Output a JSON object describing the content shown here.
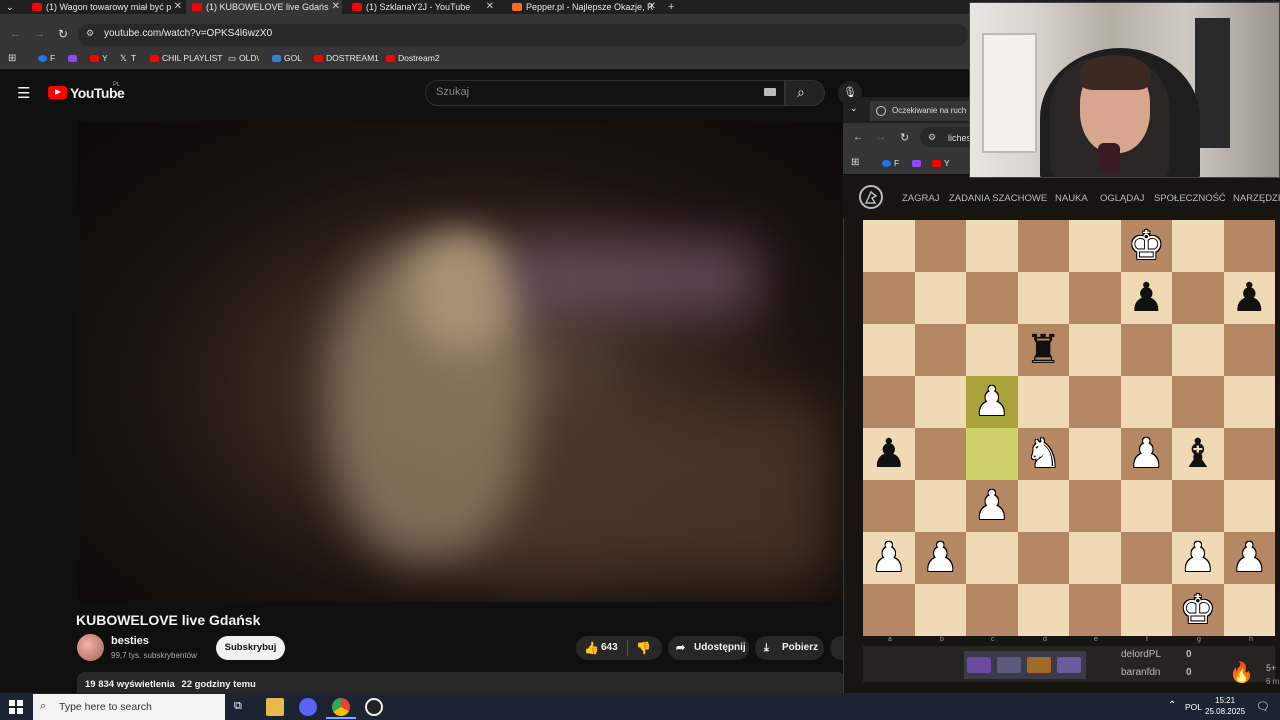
{
  "browser": {
    "tabs": [
      {
        "title": "(1) Wagon towarowy miał być p",
        "active": false
      },
      {
        "title": "(1) KUBOWELOVE live Gdańs",
        "active": true
      },
      {
        "title": "(1) SzklanaY2J - YouTube",
        "active": false
      },
      {
        "title": "Pepper.pl - Najlepsze Okazje, R",
        "active": false
      }
    ],
    "new_tab": "+",
    "url": "youtube.com/watch?v=OPKS4l6wzX0",
    "bookmarks": [
      "F",
      "Y",
      "T",
      "CHIL PLAYLIST",
      "OLD\\",
      "GOL",
      "DOSTREAM1",
      "Dostream2"
    ]
  },
  "youtube": {
    "logo_text": "YouTube",
    "region": "PL",
    "search_placeholder": "Szukaj",
    "video_title": "KUBOWELOVE live Gdańsk",
    "channel_name": "besties",
    "subscribers": "99,7 tys. subskrybentów",
    "subscribe_label": "Subskrybuj",
    "likes": "643",
    "share_label": "Udostępnij",
    "download_label": "Pobierz",
    "views": "19 834 wyświetlenia",
    "age": "22 godziny temu"
  },
  "lichess": {
    "tab_title": "Oczekiwanie na ruch p",
    "url": "liches",
    "bookmarks": [
      "F",
      "Y"
    ],
    "nav": [
      "ZAGRAJ",
      "ZADANIA SZACHOWE",
      "NAUKA",
      "OGLĄDAJ",
      "SPOŁECZNOŚĆ",
      "NARZĘDZIA"
    ],
    "files": [
      "a",
      "b",
      "c",
      "d",
      "e",
      "f",
      "g",
      "h"
    ],
    "pieces": [
      {
        "sq": "f8",
        "glyph": "♚",
        "color": "w"
      },
      {
        "sq": "f7",
        "glyph": "♟",
        "color": "b"
      },
      {
        "sq": "h7",
        "glyph": "♟",
        "color": "b"
      },
      {
        "sq": "d6",
        "glyph": "♜",
        "color": "b"
      },
      {
        "sq": "c5",
        "glyph": "♟",
        "color": "w"
      },
      {
        "sq": "a4",
        "glyph": "♟",
        "color": "b"
      },
      {
        "sq": "d4",
        "glyph": "♞",
        "color": "w"
      },
      {
        "sq": "f4",
        "glyph": "♟",
        "color": "w"
      },
      {
        "sq": "g4",
        "glyph": "♝",
        "color": "b"
      },
      {
        "sq": "c3",
        "glyph": "♟",
        "color": "w"
      },
      {
        "sq": "a2",
        "glyph": "♟",
        "color": "w"
      },
      {
        "sq": "b2",
        "glyph": "♟",
        "color": "w"
      },
      {
        "sq": "g2",
        "glyph": "♟",
        "color": "w"
      },
      {
        "sq": "h2",
        "glyph": "♟",
        "color": "w"
      },
      {
        "sq": "g1",
        "glyph": "♚",
        "color": "w"
      }
    ],
    "highlighted": [
      "c5",
      "c4"
    ],
    "players": [
      {
        "name": "delordPL",
        "score": "0"
      },
      {
        "name": "baranfdn",
        "score": "0"
      }
    ],
    "side_text": [
      "5+",
      "6 m"
    ]
  },
  "taskbar": {
    "search_placeholder": "Type here to search",
    "language": "POL",
    "time": "15:21",
    "date": "25.08.2025"
  }
}
